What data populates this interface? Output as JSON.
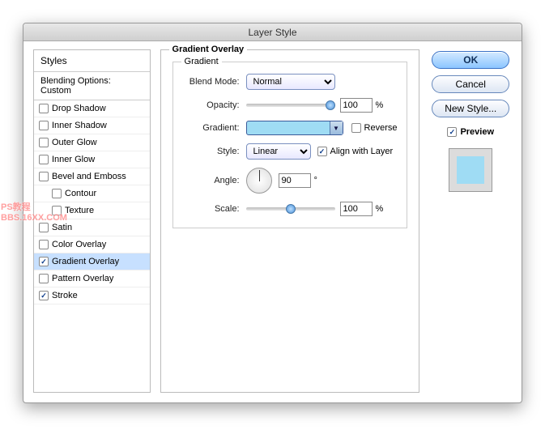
{
  "window": {
    "title": "Layer Style"
  },
  "styles_panel": {
    "header": "Styles",
    "blending_label": "Blending Options: Custom",
    "items": [
      {
        "label": "Drop Shadow",
        "checked": false,
        "child": false,
        "selected": false
      },
      {
        "label": "Inner Shadow",
        "checked": false,
        "child": false,
        "selected": false
      },
      {
        "label": "Outer Glow",
        "checked": false,
        "child": false,
        "selected": false
      },
      {
        "label": "Inner Glow",
        "checked": false,
        "child": false,
        "selected": false
      },
      {
        "label": "Bevel and Emboss",
        "checked": false,
        "child": false,
        "selected": false
      },
      {
        "label": "Contour",
        "checked": false,
        "child": true,
        "selected": false
      },
      {
        "label": "Texture",
        "checked": false,
        "child": true,
        "selected": false
      },
      {
        "label": "Satin",
        "checked": false,
        "child": false,
        "selected": false
      },
      {
        "label": "Color Overlay",
        "checked": false,
        "child": false,
        "selected": false
      },
      {
        "label": "Gradient Overlay",
        "checked": true,
        "child": false,
        "selected": true
      },
      {
        "label": "Pattern Overlay",
        "checked": false,
        "child": false,
        "selected": false
      },
      {
        "label": "Stroke",
        "checked": true,
        "child": false,
        "selected": false
      }
    ]
  },
  "center": {
    "group_title": "Gradient Overlay",
    "subgroup_title": "Gradient",
    "blend_mode": {
      "label": "Blend Mode:",
      "value": "Normal"
    },
    "opacity": {
      "label": "Opacity:",
      "value": "100",
      "unit": "%"
    },
    "gradient": {
      "label": "Gradient:",
      "reverse_label": "Reverse",
      "reverse_checked": false
    },
    "style": {
      "label": "Style:",
      "value": "Linear",
      "align_label": "Align with Layer",
      "align_checked": true
    },
    "angle": {
      "label": "Angle:",
      "value": "90",
      "unit": "°"
    },
    "scale": {
      "label": "Scale:",
      "value": "100",
      "unit": "%"
    }
  },
  "right": {
    "ok": "OK",
    "cancel": "Cancel",
    "new_style": "New Style...",
    "preview_label": "Preview",
    "preview_checked": true
  },
  "watermark": {
    "line1": "PS教程",
    "line2": "BBS.16XX.COM"
  }
}
